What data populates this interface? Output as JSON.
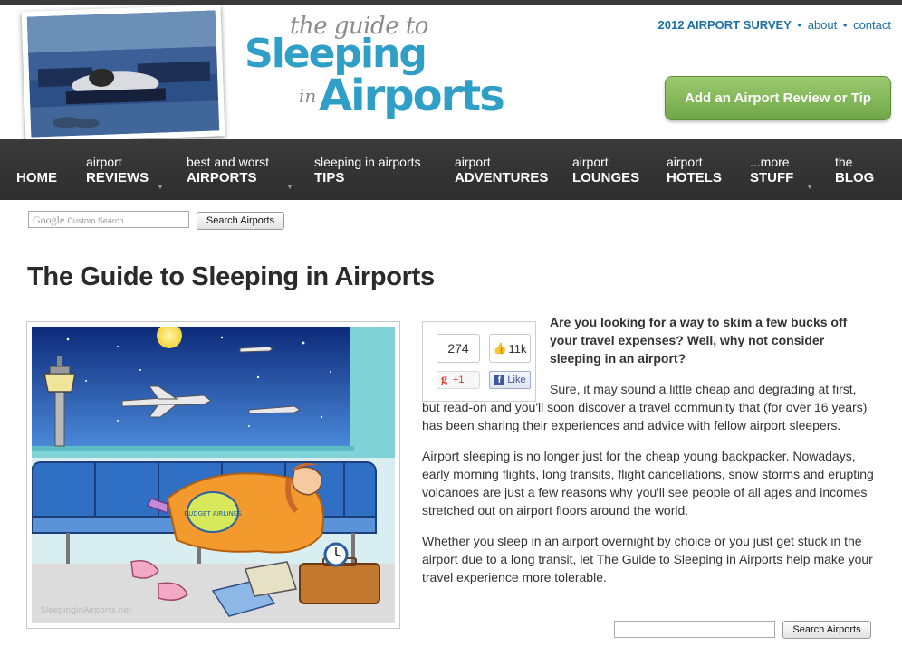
{
  "header": {
    "logo": {
      "line1": "the guide to",
      "line2": "Sleeping",
      "line3": "in",
      "line4": "Airports"
    },
    "top_links": {
      "survey": "2012 AIRPORT SURVEY",
      "about": "about",
      "contact": "contact",
      "separator": "•"
    },
    "add_review_button": "Add an Airport Review or Tip"
  },
  "nav": {
    "items": [
      {
        "small": "",
        "big": "HOME",
        "has_dropdown": false
      },
      {
        "small": "airport",
        "big": "REVIEWS",
        "has_dropdown": true
      },
      {
        "small": "best and worst",
        "big": "AIRPORTS",
        "has_dropdown": true
      },
      {
        "small": "sleeping in airports",
        "big": "TIPS",
        "has_dropdown": false
      },
      {
        "small": "airport",
        "big": "ADVENTURES",
        "has_dropdown": false
      },
      {
        "small": "airport",
        "big": "LOUNGES",
        "has_dropdown": false
      },
      {
        "small": "airport",
        "big": "HOTELS",
        "has_dropdown": false
      },
      {
        "small": "...more",
        "big": "STUFF",
        "has_dropdown": true
      },
      {
        "small": "the",
        "big": "BLOG",
        "has_dropdown": false
      }
    ]
  },
  "search": {
    "google_label": "Google",
    "google_sub": "Custom Search",
    "button_label": "Search Airports",
    "input_value": ""
  },
  "page": {
    "title": "The Guide to Sleeping in Airports"
  },
  "social": {
    "gplus_count": "274",
    "gplus_label": "+1",
    "fb_count": "11k",
    "fb_label": "Like"
  },
  "illustration": {
    "watermark": "SleepingInAirports.net",
    "bag_text": "BUDGET AIRLINES"
  },
  "article": {
    "lead": "Are you looking for a way to skim a few bucks off your travel expenses? Well, why not consider sleeping in an airport?",
    "p1": "Sure, it may sound a little cheap and degrading at first, but read-on and you'll soon discover a travel community that (for over 16 years) has been sharing their experiences and advice with fellow airport sleepers.",
    "p2": "Airport sleeping is no longer just for the cheap young backpacker. Nowadays, early morning flights, long transits, flight cancellations, snow storms and erupting volcanoes are just a few reasons why you'll see people of all ages and incomes stretched out on airport floors around the world.",
    "p3": "Whether you sleep in an airport overnight by choice or you just get stuck in the airport due to a long transit, let The Guide to Sleeping in Airports help make your travel experience more tolerable."
  },
  "colors": {
    "brand_blue": "#2f9fc7",
    "link_blue": "#1d6fa5",
    "nav_bg": "#333333",
    "add_button_green": "#7ab551"
  }
}
